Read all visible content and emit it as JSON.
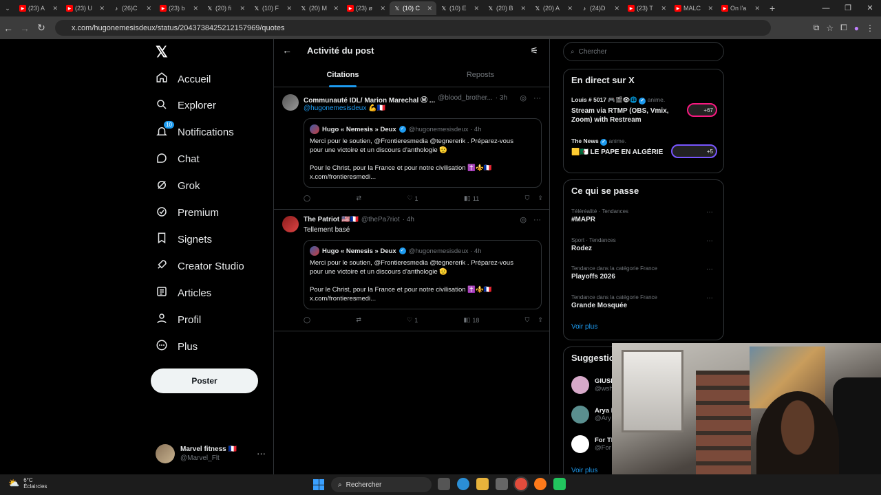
{
  "browser": {
    "tabs": [
      {
        "label": "(23) A",
        "color": "#ff0000",
        "icon": "youtube-icon"
      },
      {
        "label": "(23) U",
        "color": "#ff0000",
        "icon": "youtube-icon"
      },
      {
        "label": "(26)C",
        "color": "#ffffff",
        "icon": "tiktok-icon"
      },
      {
        "label": "(23) b",
        "color": "#ff0000",
        "icon": "youtube-icon"
      },
      {
        "label": "(20) fi",
        "color": "#ffffff",
        "icon": "x-icon"
      },
      {
        "label": "(10) F",
        "color": "#ffffff",
        "icon": "x-icon"
      },
      {
        "label": "(20) M",
        "color": "#ffffff",
        "icon": "x-icon"
      },
      {
        "label": "(23) ø",
        "color": "#ff0000",
        "icon": "youtube-icon"
      },
      {
        "label": "(10) C",
        "color": "#ffffff",
        "icon": "x-icon",
        "active": true
      },
      {
        "label": "(10) E",
        "color": "#ffffff",
        "icon": "x-icon"
      },
      {
        "label": "(20) B",
        "color": "#ffffff",
        "icon": "x-icon"
      },
      {
        "label": "(20) A",
        "color": "#ffffff",
        "icon": "x-icon"
      },
      {
        "label": "(24)D",
        "color": "#ffffff",
        "icon": "tiktok-icon"
      },
      {
        "label": "(23) T",
        "color": "#ff0000",
        "icon": "youtube-icon"
      },
      {
        "label": "MALC",
        "color": "#ff0000",
        "icon": "youtube-icon"
      },
      {
        "label": "On l'a",
        "color": "#ff0000",
        "icon": "youtube-icon"
      }
    ],
    "url": "x.com/hugonemesisdeux/status/2043738425212157969/quotes"
  },
  "nav": {
    "items": [
      {
        "label": "Accueil",
        "icon": "home-icon"
      },
      {
        "label": "Explorer",
        "icon": "search-icon"
      },
      {
        "label": "Notifications",
        "icon": "bell-icon",
        "badge": "10"
      },
      {
        "label": "Chat",
        "icon": "chat-icon"
      },
      {
        "label": "Grok",
        "icon": "grok-icon"
      },
      {
        "label": "Premium",
        "icon": "premium-icon"
      },
      {
        "label": "Signets",
        "icon": "bookmark-icon"
      },
      {
        "label": "Creator Studio",
        "icon": "rocket-icon"
      },
      {
        "label": "Articles",
        "icon": "article-icon"
      },
      {
        "label": "Profil",
        "icon": "person-icon"
      },
      {
        "label": "Plus",
        "icon": "more-icon"
      }
    ],
    "post_button": "Poster",
    "account": {
      "name": "Marvel fitness 🇫🇷",
      "handle": "@Marvel_Flt"
    }
  },
  "main": {
    "title": "Activité du post",
    "tabs": [
      {
        "label": "Citations",
        "active": true
      },
      {
        "label": "Reposts"
      }
    ],
    "tweets": [
      {
        "name": "Communauté IDL/ Marion Marechal Ⓜ ...",
        "handle": "@blood_brother...",
        "time": "· 3h",
        "text_link": "@hugonemesisdeux",
        "text": "💪🇫🇷",
        "quote": {
          "name": "Hugo « Nemesis » Deux",
          "handle": "@hugonemesisdeux · 4h",
          "line1": "Merci pour le soutien, @Frontieresmedia @tegnererik . Préparez-vous",
          "line2": "pour une victoire et un discours d'anthologie 🫡",
          "line3": "Pour le Christ, pour la France et pour notre civilisation ✝️⚜️🇫🇷",
          "line4": "x.com/frontieresmedi..."
        },
        "likes": "1",
        "views": "11"
      },
      {
        "name": "The Patriot 🇺🇸🇫🇷",
        "handle": "@thePa7riot",
        "time": "· 4h",
        "text_link": "",
        "text": "Tellement basé",
        "quote": {
          "name": "Hugo « Nemesis » Deux",
          "handle": "@hugonemesisdeux · 4h",
          "line1": "Merci pour le soutien, @Frontieresmedia @tegnererik . Préparez-vous",
          "line2": "pour une victoire et un discours d'anthologie 🫡",
          "line3": "Pour le Christ, pour la France et pour notre civilisation ✝️⚜️🇫🇷",
          "line4": "x.com/frontieresmedi..."
        },
        "likes": "1",
        "views": "18"
      }
    ]
  },
  "sidebar": {
    "search_placeholder": "Chercher",
    "live": {
      "title": "En direct sur X",
      "items": [
        {
          "source": "Louis # 5017 🎮🎬👁🌐",
          "tag": "anime.",
          "title": "Stream via RTMP (OBS, Vmix, Zoom) with Restream",
          "count": "+67"
        },
        {
          "source": "The News",
          "tag": "anime.",
          "title": "🟨🇩🇿 LE PAPE EN ALGÉRIE",
          "count": "+5"
        }
      ]
    },
    "trends": {
      "title": "Ce qui se passe",
      "items": [
        {
          "category": "Téléréalité · Tendances",
          "name": "#MAPR"
        },
        {
          "category": "Sport · Tendances",
          "name": "Rodez"
        },
        {
          "category": "Tendance dans la catégorie France",
          "name": "Playoffs 2026"
        },
        {
          "category": "Tendance dans la catégorie France",
          "name": "Grande Mosquée"
        }
      ],
      "more": "Voir plus"
    },
    "suggestions": {
      "title": "Suggestio",
      "items": [
        {
          "name": "GIUSE",
          "handle": "@wsh"
        },
        {
          "name": "Arya I",
          "handle": "@Ary"
        },
        {
          "name": "For Th",
          "handle": "@For"
        }
      ],
      "more": "Voir plus"
    }
  },
  "taskbar": {
    "temp": "6°C",
    "weather": "Éclaircies",
    "search": "Rechercher"
  }
}
